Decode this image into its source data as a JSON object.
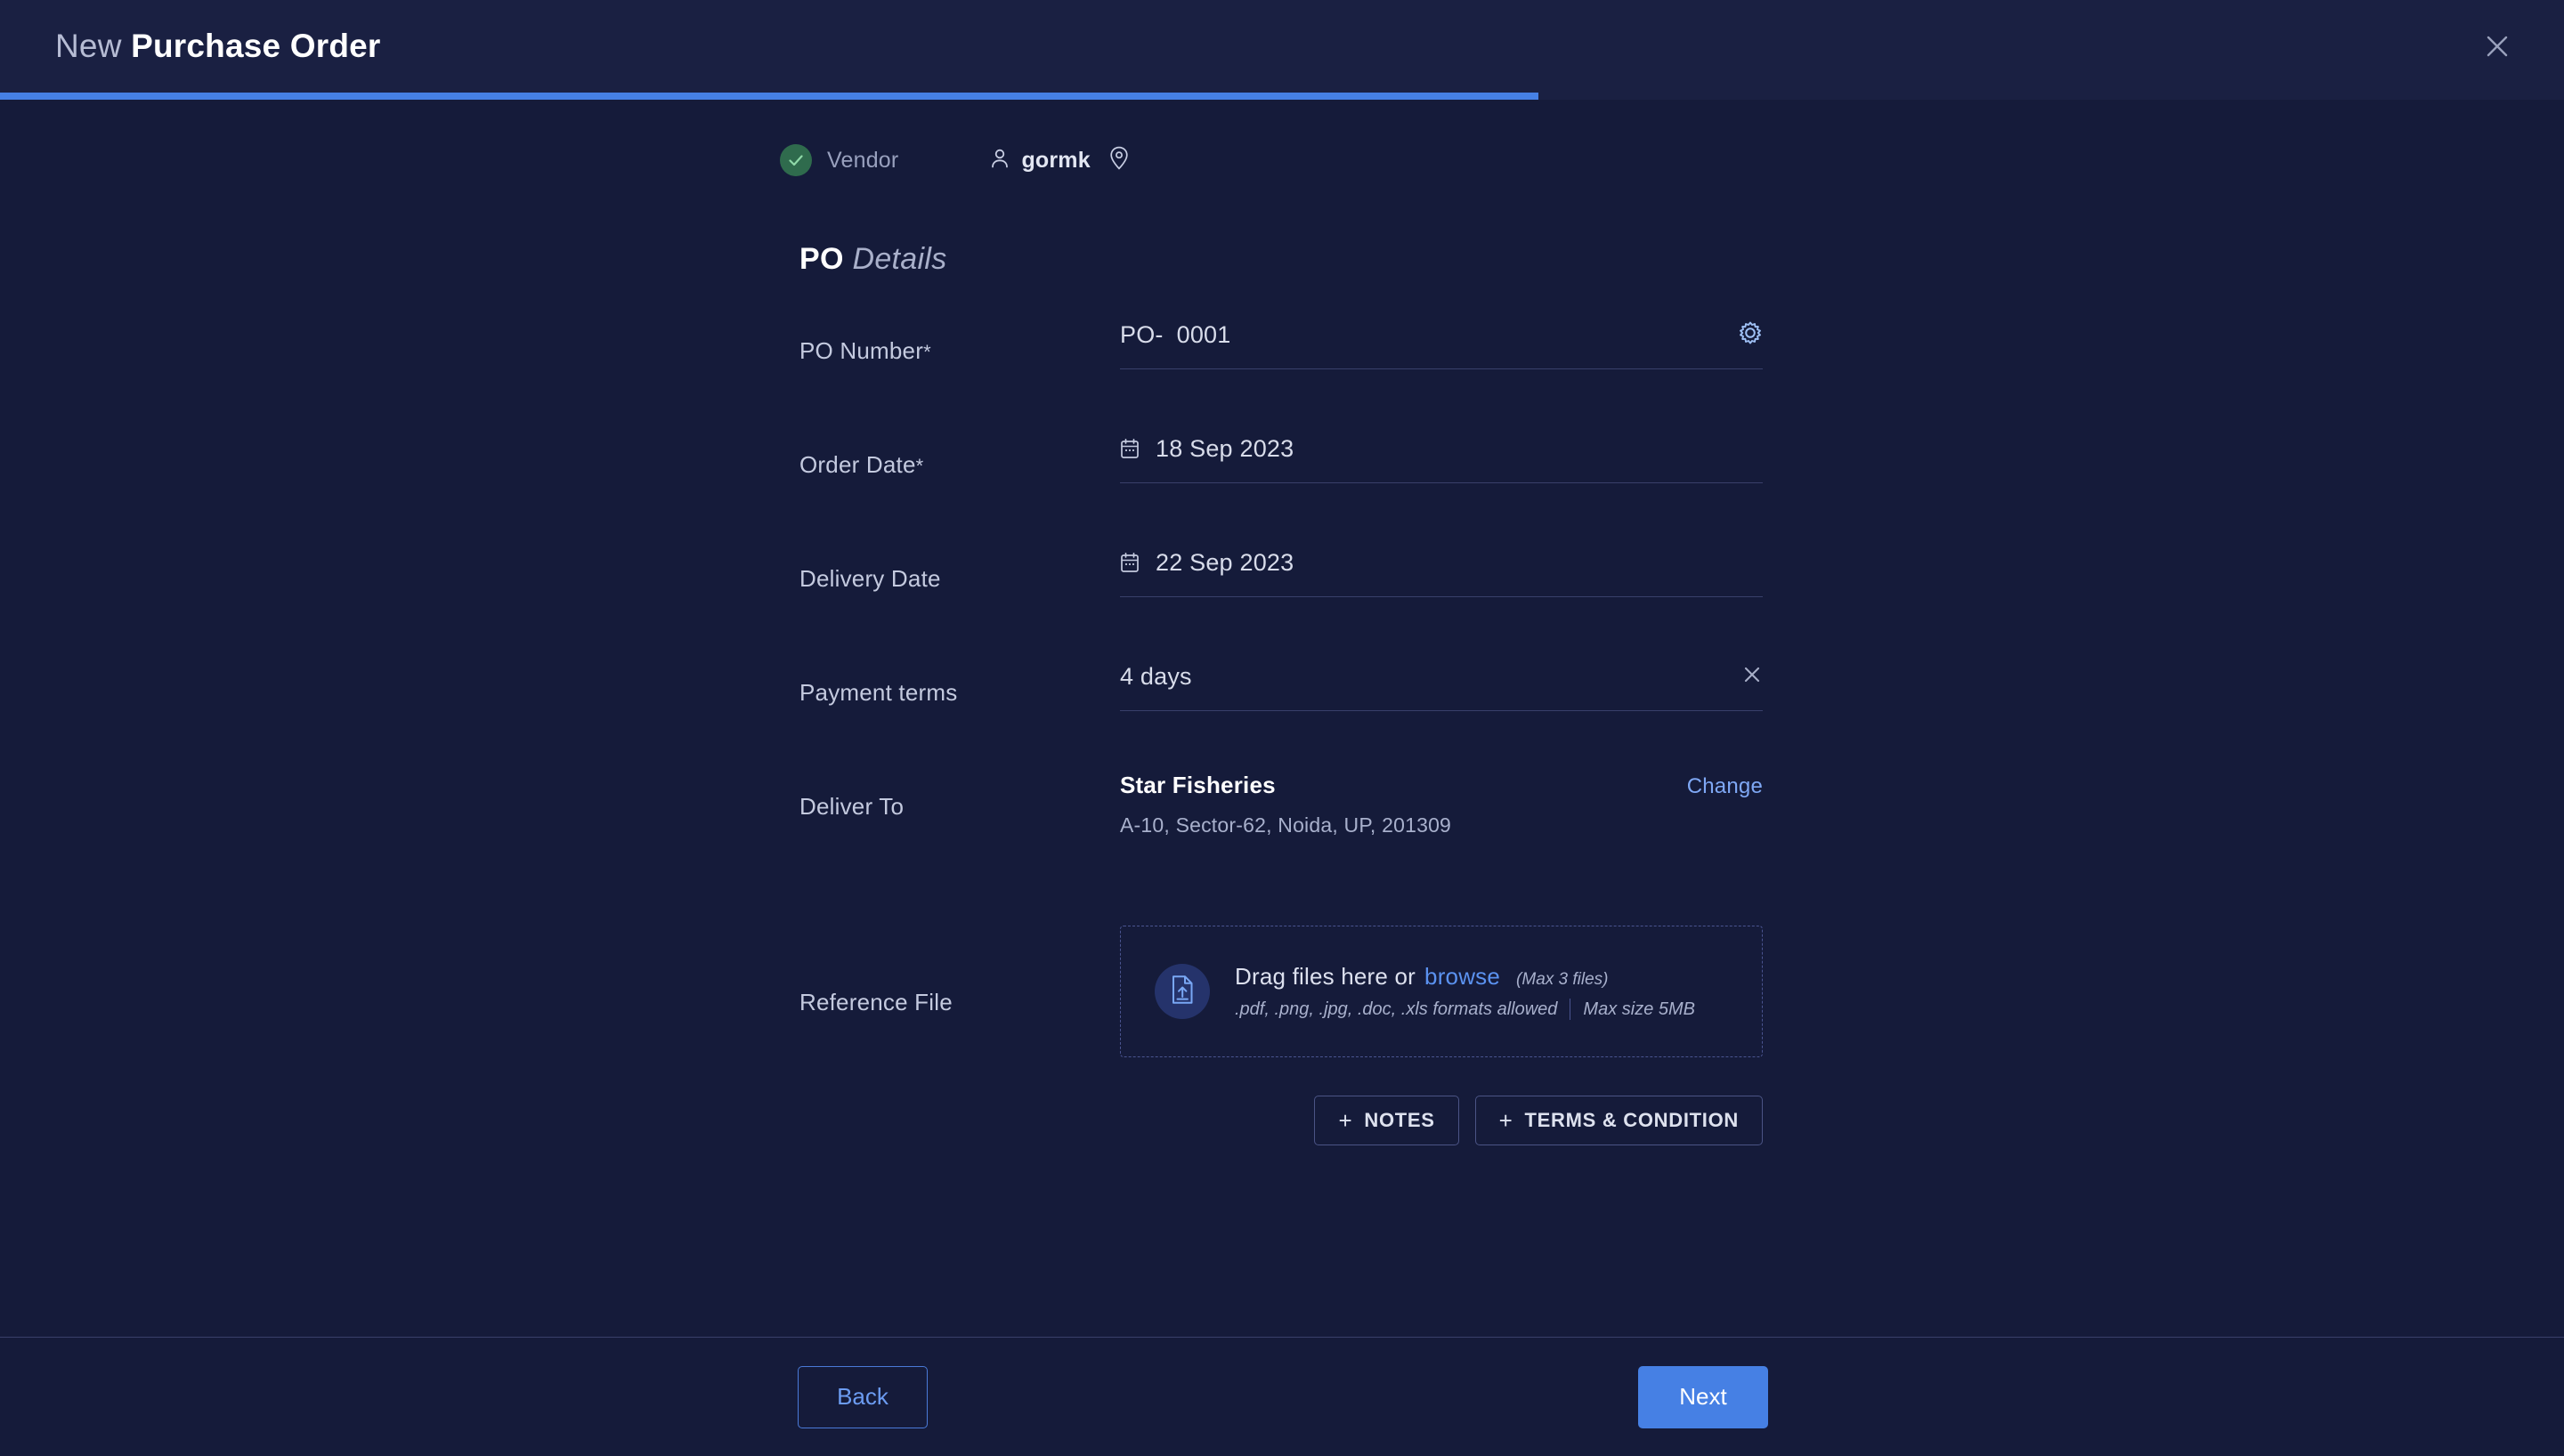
{
  "header": {
    "title_light": "New",
    "title_bold": "Purchase Order",
    "close_icon": "close-icon"
  },
  "progress": {
    "percent": 60
  },
  "stepper": {
    "step_vendor_label": "Vendor",
    "step_vendor_icon": "check-circle-icon",
    "user_icon": "person-icon",
    "user_name": "gormk",
    "location_icon": "map-pin-icon"
  },
  "form": {
    "section_title_bold": "PO",
    "section_title_light": "Details",
    "po_number": {
      "label": "PO Number",
      "required_mark": "*",
      "prefix": "PO-",
      "value": "0001",
      "action_icon": "gear-icon"
    },
    "order_date": {
      "label": "Order Date",
      "required_mark": "*",
      "value": "18 Sep 2023",
      "icon": "calendar-icon"
    },
    "delivery_date": {
      "label": "Delivery Date",
      "required_mark": "",
      "value": "22 Sep 2023",
      "icon": "calendar-icon"
    },
    "payment_terms": {
      "label": "Payment terms",
      "value": "4 days",
      "clear_icon": "close-icon"
    },
    "deliver_to": {
      "label": "Deliver To",
      "name": "Star Fisheries",
      "address": "A-10, Sector-62, Noida, UP, 201309",
      "change_label": "Change"
    },
    "reference_file": {
      "label": "Reference File",
      "icon": "file-upload-icon",
      "drag_text": "Drag files here or",
      "browse_label": "browse",
      "max_files": "(Max 3 files)",
      "formats": ".pdf, .png, .jpg, .doc, .xls formats allowed",
      "max_size": "Max size 5MB"
    },
    "add_buttons": {
      "plus": "+",
      "notes_label": "NOTES",
      "terms_label": "TERMS & CONDITION"
    }
  },
  "footer": {
    "back_label": "Back",
    "next_label": "Next"
  },
  "colors": {
    "background": "#151B3A",
    "header": "#1A2042",
    "accent_blue": "#4680E4",
    "link_blue": "#7FA8F5",
    "success_green": "#2F6B4D",
    "divider": "#39406A"
  }
}
